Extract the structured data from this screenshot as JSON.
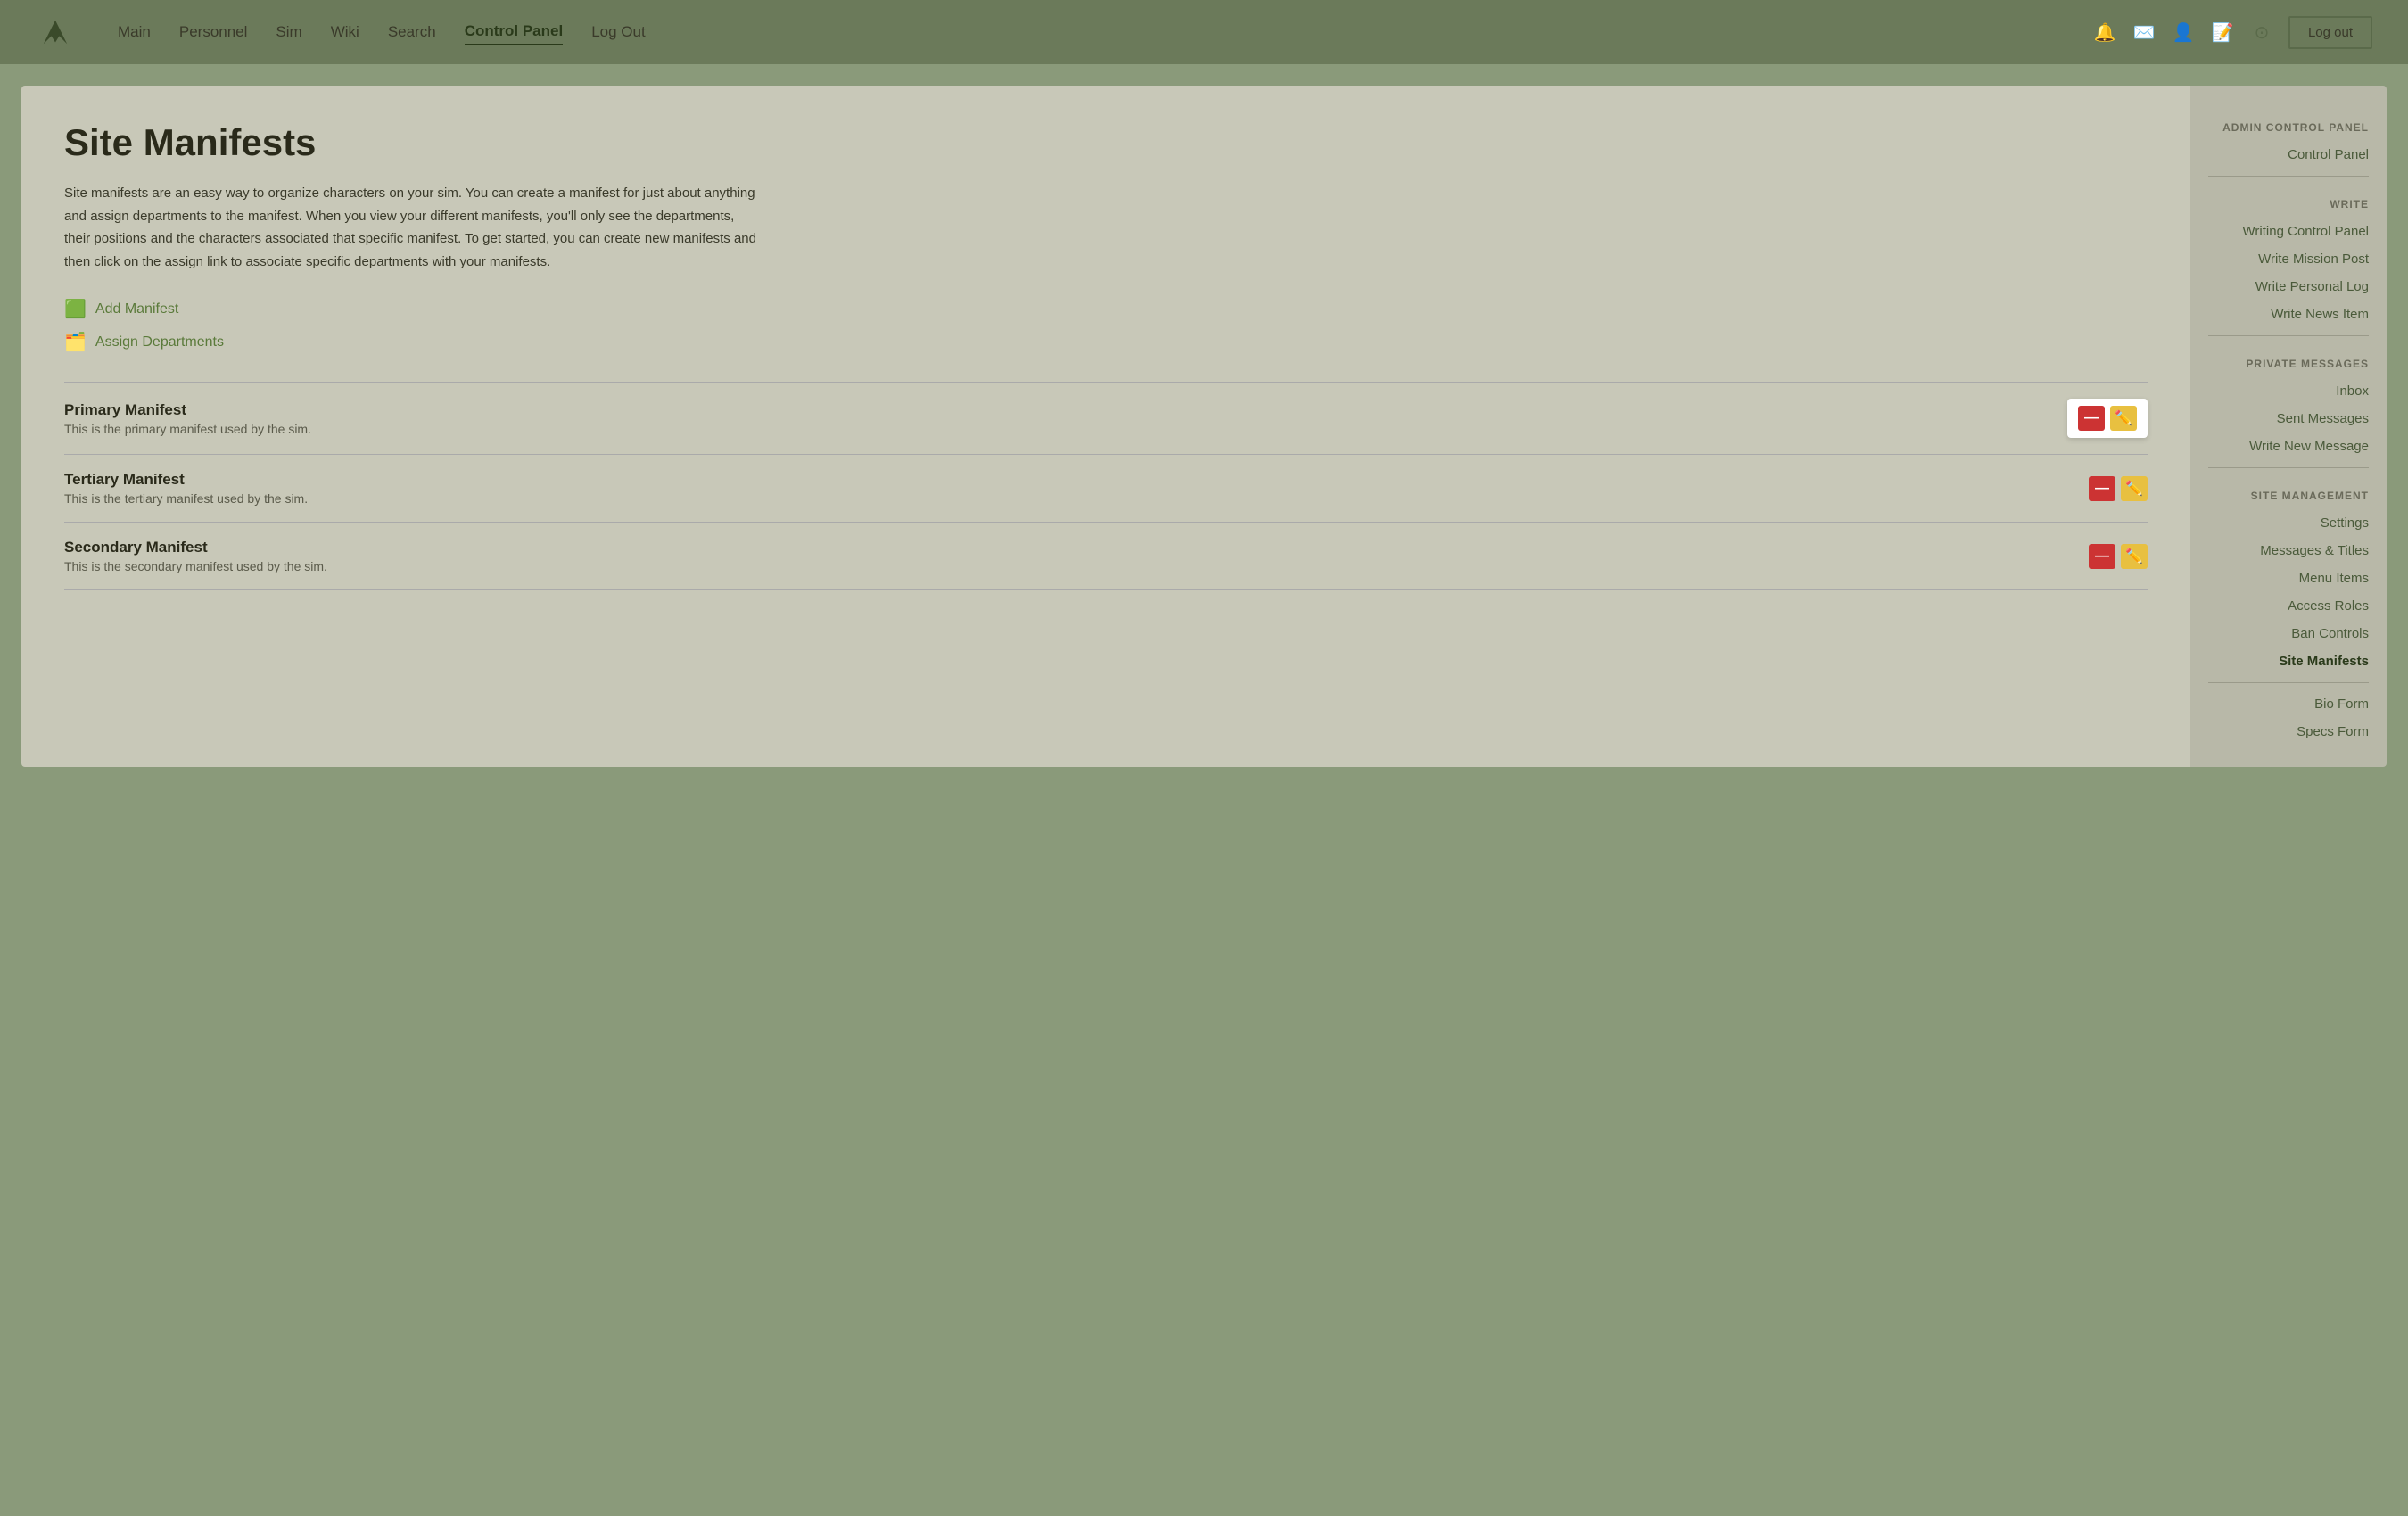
{
  "nav": {
    "logo_alt": "NOVA",
    "links": [
      {
        "label": "Main",
        "active": false
      },
      {
        "label": "Personnel",
        "active": false
      },
      {
        "label": "Sim",
        "active": false
      },
      {
        "label": "Wiki",
        "active": false
      },
      {
        "label": "Search",
        "active": false
      },
      {
        "label": "Control Panel",
        "active": true
      },
      {
        "label": "Log Out",
        "active": false
      }
    ],
    "logout_label": "Log out"
  },
  "page": {
    "title": "Site Manifests",
    "description": "Site manifests are an easy way to organize characters on your sim. You can create a manifest for just about anything and assign departments to the manifest. When you view your different manifests, you'll only see the departments, their positions and the characters associated that specific manifest. To get started, you can create new manifests and then click on the assign link to associate specific departments with your manifests."
  },
  "actions": [
    {
      "icon": "➕",
      "label": "Add Manifest"
    },
    {
      "icon": "📦",
      "label": "Assign Departments"
    }
  ],
  "manifests": [
    {
      "name": "Primary Manifest",
      "description": "This is the primary manifest used by the sim."
    },
    {
      "name": "Tertiary Manifest",
      "description": "This is the tertiary manifest used by the sim."
    },
    {
      "name": "Secondary Manifest",
      "description": "This is the secondary manifest used by the sim."
    }
  ],
  "sidebar": {
    "admin_title": "ADMIN CONTROL PANEL",
    "control_panel_label": "Control Panel",
    "write_title": "WRITE",
    "write_links": [
      {
        "label": "Writing Control Panel"
      },
      {
        "label": "Write Mission Post"
      },
      {
        "label": "Write Personal Log"
      },
      {
        "label": "Write News Item"
      }
    ],
    "private_messages_title": "PRIVATE MESSAGES",
    "pm_links": [
      {
        "label": "Inbox"
      },
      {
        "label": "Sent Messages"
      },
      {
        "label": "Write New Message"
      }
    ],
    "site_management_title": "SITE MANAGEMENT",
    "sm_links": [
      {
        "label": "Settings"
      },
      {
        "label": "Messages & Titles"
      },
      {
        "label": "Menu Items"
      },
      {
        "label": "Access Roles"
      },
      {
        "label": "Ban Controls"
      },
      {
        "label": "Site Manifests",
        "active": true
      }
    ],
    "bottom_links": [
      {
        "label": "Bio Form"
      },
      {
        "label": "Specs Form"
      }
    ]
  }
}
